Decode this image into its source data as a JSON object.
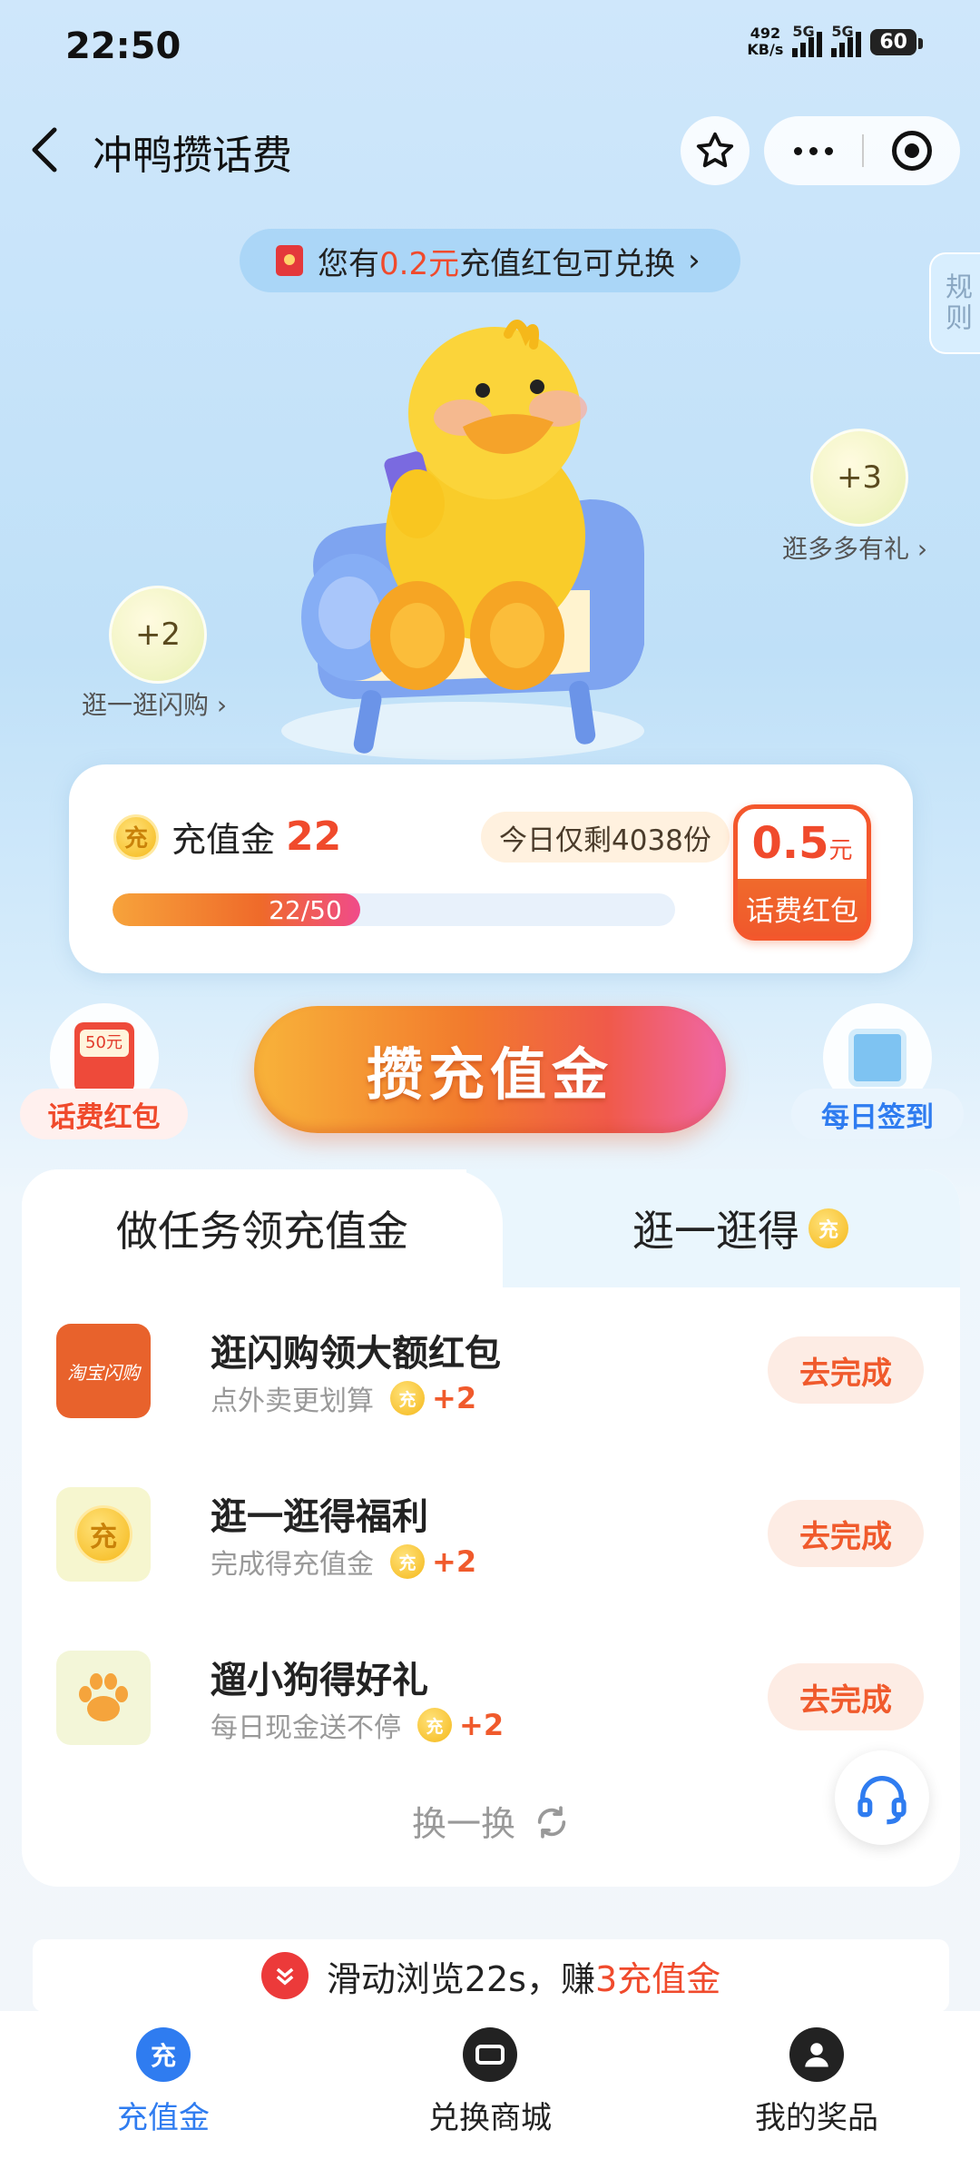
{
  "status": {
    "time": "22:50",
    "speed_value": "492",
    "speed_unit": "KB/s",
    "sim1": "5G",
    "sim2": "5G",
    "battery": "60"
  },
  "header": {
    "title": "冲鸭攒话费"
  },
  "banner": {
    "prefix": "您有",
    "amount": "0.2元",
    "suffix": "充值红包可兑换",
    "arrow": "›"
  },
  "rules": {
    "label": "规则"
  },
  "bubbles": {
    "left": {
      "value": "+2",
      "label": "逛一逛闪购 ›"
    },
    "right": {
      "value": "+3",
      "label": "逛多多有礼 ›"
    }
  },
  "progress": {
    "coin_symbol": "充",
    "label": "充值金",
    "count": "22",
    "remaining": "今日仅剩4038份",
    "current": 22,
    "target": 50,
    "progress_text": "22/50",
    "reward_amount": "0.5",
    "reward_unit": "元",
    "reward_name": "话费红包"
  },
  "actions": {
    "left_label": "话费红包",
    "left_badge": "50元",
    "main_label": "攒充值金",
    "right_label": "每日签到"
  },
  "tabs": {
    "active": "做任务领充值金",
    "inactive": "逛一逛得",
    "coin_symbol": "充"
  },
  "tasks": [
    {
      "icon_text": "淘宝闪购",
      "title": "逛闪购领大额红包",
      "subtitle": "点外卖更划算",
      "reward": "+2",
      "button": "去完成"
    },
    {
      "icon_text": "充",
      "title": "逛一逛得福利",
      "subtitle": "完成得充值金",
      "reward": "+2",
      "button": "去完成"
    },
    {
      "icon_text": "",
      "title": "遛小狗得好礼",
      "subtitle": "每日现金送不停",
      "reward": "+2",
      "button": "去完成"
    }
  ],
  "refresh_label": "换一换",
  "browse": {
    "prefix": "滑动浏览22s，赚",
    "amount": "3充值金"
  },
  "nav": [
    {
      "label": "充值金",
      "icon": "充",
      "color": "#2f7cf0",
      "active": true
    },
    {
      "label": "兑换商城",
      "icon": "",
      "color": "#222222",
      "active": false
    },
    {
      "label": "我的奖品",
      "icon": "",
      "color": "#222222",
      "active": false
    }
  ],
  "colors": {
    "accent_orange": "#f05a2c",
    "active_blue": "#2f7cf0"
  }
}
